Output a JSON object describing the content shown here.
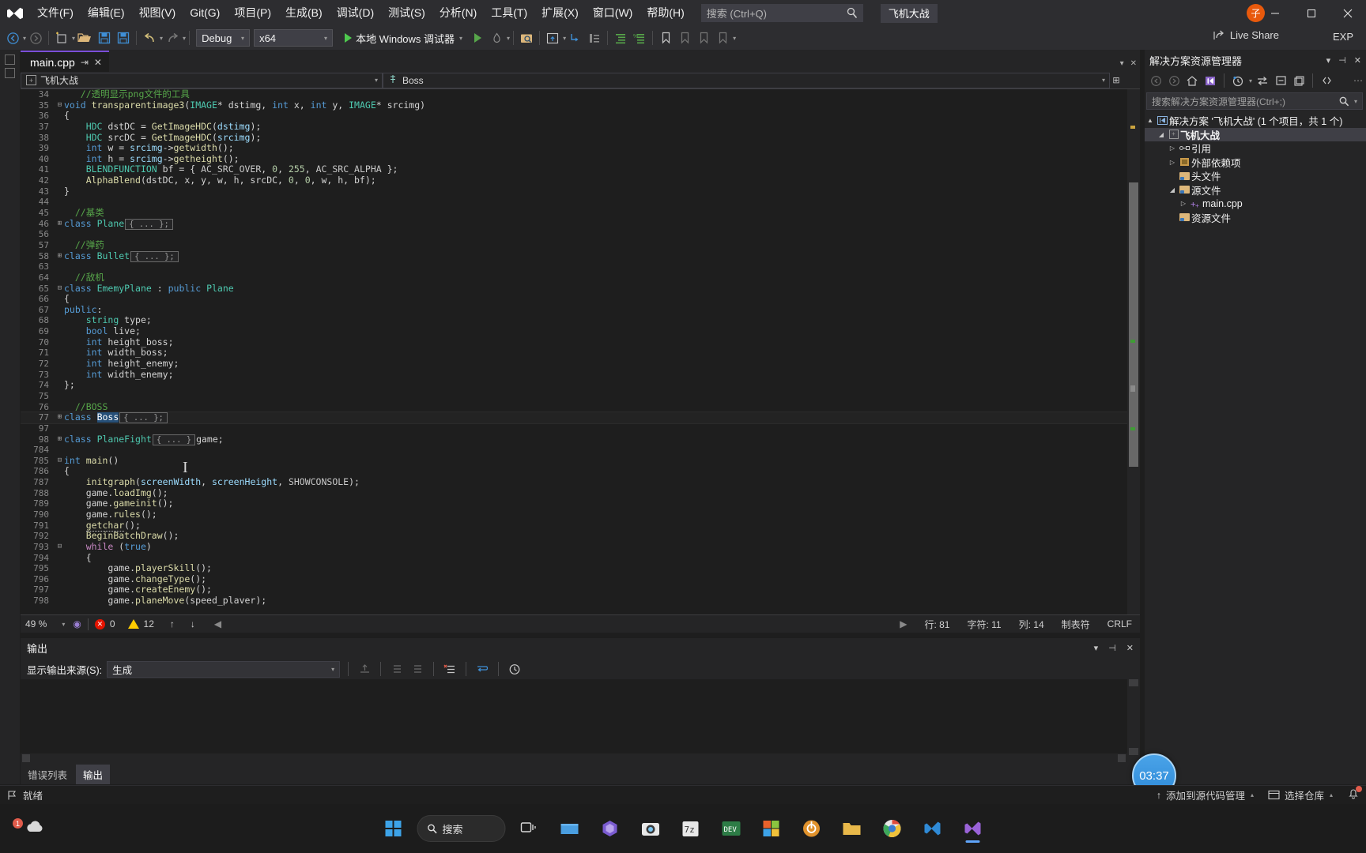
{
  "menubar": {
    "items": [
      {
        "label": "文件(F)"
      },
      {
        "label": "编辑(E)"
      },
      {
        "label": "视图(V)"
      },
      {
        "label": "Git(G)"
      },
      {
        "label": "项目(P)"
      },
      {
        "label": "生成(B)"
      },
      {
        "label": "调试(D)"
      },
      {
        "label": "测试(S)"
      },
      {
        "label": "分析(N)"
      },
      {
        "label": "工具(T)"
      },
      {
        "label": "扩展(X)"
      },
      {
        "label": "窗口(W)"
      },
      {
        "label": "帮助(H)"
      }
    ],
    "search_placeholder": "搜索 (Ctrl+Q)",
    "project_chip": "飞机大战",
    "avatar_initial": "子"
  },
  "toolbar": {
    "configuration": "Debug",
    "platform": "x64",
    "run_label": "本地 Windows 调试器",
    "live_share": "Live Share",
    "exp_label": "EXP"
  },
  "editor": {
    "tab_title": "main.cpp",
    "nav_project": "飞机大战",
    "nav_member": "Boss",
    "lines": [
      {
        "num": "34",
        "fold": "",
        "html": "   <span class=\"cm\">//透明显示png文件的工具</span>"
      },
      {
        "num": "35",
        "fold": "⊟",
        "html": "<span class=\"k\">void</span> <span class=\"mc\">transparentimage3</span>(<span class=\"t\">IMAGE</span>* dstimg, <span class=\"k\">int</span> x, <span class=\"k\">int</span> y, <span class=\"t\">IMAGE</span>* srcimg)"
      },
      {
        "num": "36",
        "fold": "",
        "html": "{"
      },
      {
        "num": "37",
        "fold": "",
        "html": "    <span class=\"t\">HDC</span> dstDC = <span class=\"mc\">GetImageHDC</span>(<span class=\"v\">dstimg</span>);"
      },
      {
        "num": "38",
        "fold": "",
        "html": "    <span class=\"t\">HDC</span> srcDC = <span class=\"mc\">GetImageHDC</span>(<span class=\"v\">srcimg</span>);"
      },
      {
        "num": "39",
        "fold": "",
        "html": "    <span class=\"k\">int</span> w = <span class=\"v\">srcimg</span>-&gt;<span class=\"mc\">getwidth</span>();"
      },
      {
        "num": "40",
        "fold": "",
        "html": "    <span class=\"k\">int</span> h = <span class=\"v\">srcimg</span>-&gt;<span class=\"mc\">getheight</span>();"
      },
      {
        "num": "41",
        "fold": "",
        "html": "    <span class=\"t\">BLENDFUNCTION</span> bf = { <span class=\"m\">AC_SRC_OVER</span>, <span class=\"n\">0</span>, <span class=\"n\">255</span>, <span class=\"m\">AC_SRC_ALPHA</span> };"
      },
      {
        "num": "42",
        "fold": "",
        "html": "    <span class=\"mc\">AlphaBlend</span>(dstDC, x, y, w, h, srcDC, <span class=\"n\">0</span>, <span class=\"n\">0</span>, w, h, bf);"
      },
      {
        "num": "43",
        "fold": "",
        "html": "}"
      },
      {
        "num": "44",
        "fold": "",
        "html": ""
      },
      {
        "num": "45",
        "fold": "",
        "html": "  <span class=\"cm\">//基类</span>"
      },
      {
        "num": "46",
        "fold": "⊞",
        "html": "<span class=\"k\">class</span> <span class=\"t\">Plane</span><span class=\"collapsed\">{ ... };</span>"
      },
      {
        "num": "56",
        "fold": "",
        "html": ""
      },
      {
        "num": "57",
        "fold": "",
        "html": "  <span class=\"cm\">//弹药</span>"
      },
      {
        "num": "58",
        "fold": "⊞",
        "html": "<span class=\"k\">class</span> <span class=\"t\">Bullet</span><span class=\"collapsed\">{ ... };</span>"
      },
      {
        "num": "63",
        "fold": "",
        "html": ""
      },
      {
        "num": "64",
        "fold": "",
        "html": "  <span class=\"cm\">//敌机</span>"
      },
      {
        "num": "65",
        "fold": "⊟",
        "html": "<span class=\"k\">class</span> <span class=\"t\">EmemyPlane</span> : <span class=\"k\">public</span> <span class=\"t\">Plane</span>"
      },
      {
        "num": "66",
        "fold": "",
        "html": "{"
      },
      {
        "num": "67",
        "fold": "",
        "html": "<span class=\"k\">public</span>:"
      },
      {
        "num": "68",
        "fold": "",
        "html": "    <span class=\"t\">string</span> type;"
      },
      {
        "num": "69",
        "fold": "",
        "html": "    <span class=\"k\">bool</span> live;"
      },
      {
        "num": "70",
        "fold": "",
        "html": "    <span class=\"k\">int</span> height_boss;"
      },
      {
        "num": "71",
        "fold": "",
        "html": "    <span class=\"k\">int</span> width_boss;"
      },
      {
        "num": "72",
        "fold": "",
        "html": "    <span class=\"k\">int</span> height_enemy;"
      },
      {
        "num": "73",
        "fold": "",
        "html": "    <span class=\"k\">int</span> width_enemy;"
      },
      {
        "num": "74",
        "fold": "",
        "html": "};"
      },
      {
        "num": "75",
        "fold": "",
        "html": ""
      },
      {
        "num": "76",
        "fold": "",
        "html": "  <span class=\"cm\">//BOSS</span>"
      },
      {
        "num": "77",
        "fold": "⊞",
        "html": "<span class=\"k\">class</span> <span class=\"selhl\">Boss</span><span class=\"collapsed\">{ ... };</span>",
        "current": true
      },
      {
        "num": "97",
        "fold": "",
        "html": ""
      },
      {
        "num": "98",
        "fold": "⊞",
        "html": "<span class=\"k\">class</span> <span class=\"t\">PlaneFight</span><span class=\"collapsed\">{ ... }</span>game;"
      },
      {
        "num": "784",
        "fold": "",
        "html": ""
      },
      {
        "num": "785",
        "fold": "⊟",
        "html": "<span class=\"k\">int</span> <span class=\"mc\">main</span>()"
      },
      {
        "num": "786",
        "fold": "",
        "html": "{"
      },
      {
        "num": "787",
        "fold": "",
        "html": "    <span class=\"mc\">initgraph</span>(<span class=\"v\">screenWidth</span>, <span class=\"v\">screenHeight</span>, <span class=\"m\">SHOWCONSOLE</span>);"
      },
      {
        "num": "788",
        "fold": "",
        "html": "    game.<span class=\"mc\">loadImg</span>();"
      },
      {
        "num": "789",
        "fold": "",
        "html": "    game.<span class=\"mc\">gameinit</span>();"
      },
      {
        "num": "790",
        "fold": "",
        "html": "    game.<span class=\"mc\">rules</span>();"
      },
      {
        "num": "791",
        "fold": "",
        "html": "    <span class=\"mc ul-err\">getchar</span>();"
      },
      {
        "num": "792",
        "fold": "",
        "html": "    <span class=\"mc\">BeginBatchDraw</span>();"
      },
      {
        "num": "793",
        "fold": "⊟",
        "html": "    <span class=\"kp\">while</span> (<span class=\"k\">true</span>)"
      },
      {
        "num": "794",
        "fold": "",
        "html": "    {"
      },
      {
        "num": "795",
        "fold": "",
        "html": "        game.<span class=\"mc\">playerSkill</span>();"
      },
      {
        "num": "796",
        "fold": "",
        "html": "        game.<span class=\"mc\">changeType</span>();"
      },
      {
        "num": "797",
        "fold": "",
        "html": "        game.<span class=\"mc\">createEnemy</span>();"
      },
      {
        "num": "798",
        "fold": "",
        "html": "        game.<span class=\"mc\">planeMove</span>(speed_plaver);"
      }
    ],
    "status": {
      "zoom": "49 %",
      "errors": "0",
      "warnings": "12",
      "line": "行: 81",
      "chars": "字符: 11",
      "col": "列: 14",
      "indent": "制表符",
      "eol": "CRLF"
    }
  },
  "solution_explorer": {
    "title": "解决方案资源管理器",
    "search_placeholder": "搜索解决方案资源管理器(Ctrl+;)",
    "tree": [
      {
        "indent": 0,
        "arrow": "▲",
        "icon": "solution-icon",
        "label": "解决方案 '飞机大战' (1 个项目，共 1 个)",
        "bold": false
      },
      {
        "indent": 1,
        "arrow": "◢",
        "icon": "project-icon",
        "label": "飞机大战",
        "bold": true,
        "selected": true
      },
      {
        "indent": 2,
        "arrow": "▷",
        "icon": "references-icon",
        "label": "引用",
        "bold": false
      },
      {
        "indent": 2,
        "arrow": "▷",
        "icon": "external-deps-icon",
        "label": "外部依赖项",
        "bold": false
      },
      {
        "indent": 2,
        "arrow": "",
        "icon": "folder-icon",
        "label": "头文件",
        "bold": false
      },
      {
        "indent": 2,
        "arrow": "◢",
        "icon": "folder-icon",
        "label": "源文件",
        "bold": false
      },
      {
        "indent": 3,
        "arrow": "▷",
        "icon": "cpp-file-icon",
        "label": "main.cpp",
        "bold": false
      },
      {
        "indent": 2,
        "arrow": "",
        "icon": "folder-icon",
        "label": "资源文件",
        "bold": false
      }
    ]
  },
  "output_panel": {
    "title": "输出",
    "source_label": "显示输出来源(S):",
    "source_value": "生成",
    "tabs": [
      {
        "label": "错误列表",
        "active": false
      },
      {
        "label": "输出",
        "active": true
      }
    ]
  },
  "statusbar": {
    "ready": "就绪",
    "source_control": "添加到源代码管理",
    "repo": "选择仓库"
  },
  "taskbar": {
    "search_label": "搜索",
    "clock": "03:37",
    "icons": [
      {
        "name": "start-button"
      },
      {
        "name": "search-box"
      },
      {
        "name": "task-view"
      },
      {
        "name": "file-explorer-blue"
      },
      {
        "name": "app-purple"
      },
      {
        "name": "camera-app"
      },
      {
        "name": "app-7z"
      },
      {
        "name": "dev-app"
      },
      {
        "name": "office-app"
      },
      {
        "name": "app-circle"
      },
      {
        "name": "folder-app"
      },
      {
        "name": "chrome"
      },
      {
        "name": "vscode"
      },
      {
        "name": "visual-studio"
      }
    ]
  }
}
